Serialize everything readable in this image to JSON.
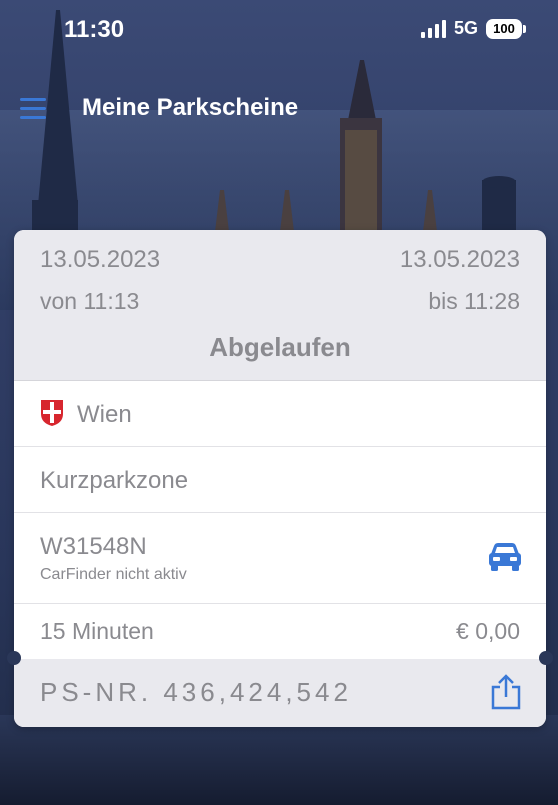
{
  "status": {
    "time": "11:30",
    "network": "5G",
    "battery": "100"
  },
  "header": {
    "title": "Meine Parkscheine"
  },
  "ticket": {
    "start_date": "13.05.2023",
    "end_date": "13.05.2023",
    "from_time": "von 11:13",
    "to_time": "bis 11:28",
    "state": "Abgelaufen",
    "city": "Wien",
    "zone": "Kurzparkzone",
    "plate": "W31548N",
    "carfinder": "CarFinder nicht aktiv",
    "duration": "15 Minuten",
    "price": "€ 0,00",
    "ps_number": "PS-NR. 436,424,542"
  },
  "colors": {
    "accent": "#3a78d6",
    "text_gray": "#8a8a8f"
  }
}
